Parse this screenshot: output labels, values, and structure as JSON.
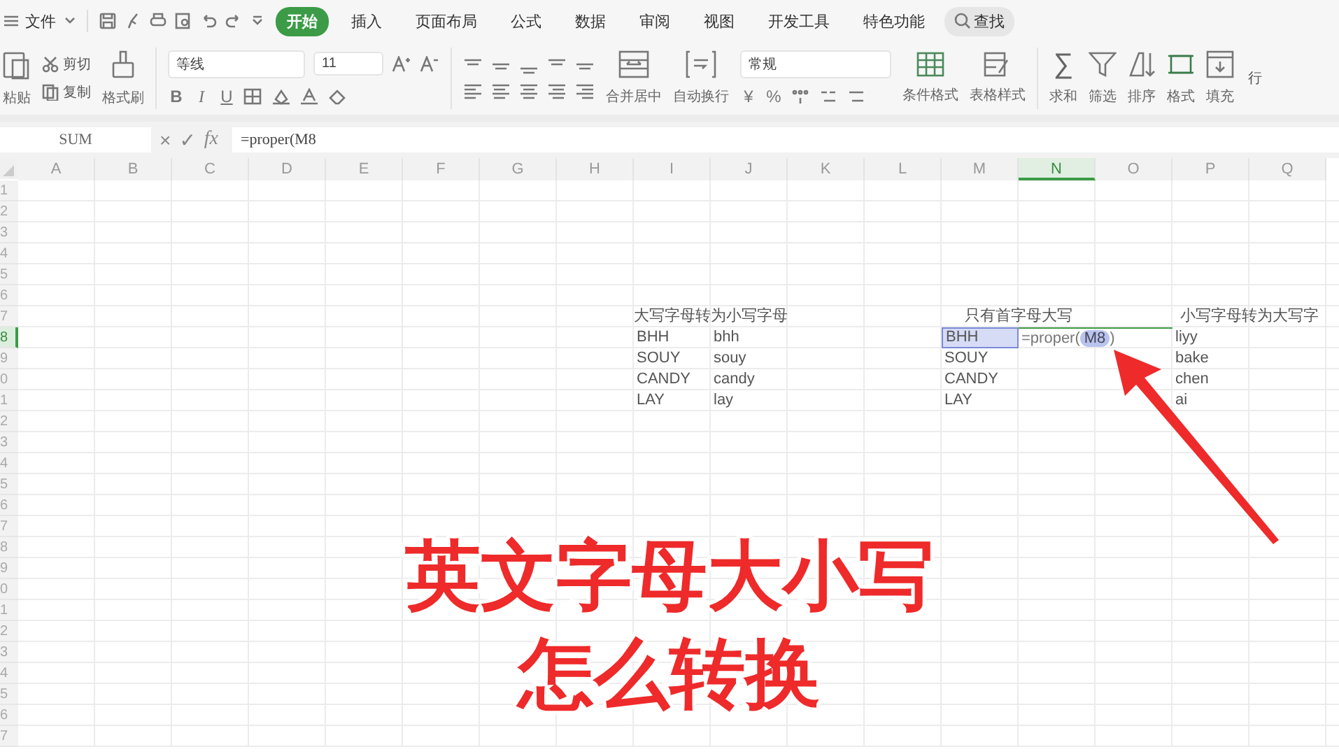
{
  "menu": {
    "label": "文件"
  },
  "tabs": [
    {
      "label": "开始",
      "selected": true
    },
    {
      "label": "插入",
      "selected": false
    },
    {
      "label": "页面布局",
      "selected": false
    },
    {
      "label": "公式",
      "selected": false
    },
    {
      "label": "数据",
      "selected": false
    },
    {
      "label": "审阅",
      "selected": false
    },
    {
      "label": "视图",
      "selected": false
    },
    {
      "label": "开发工具",
      "selected": false
    },
    {
      "label": "特色功能",
      "selected": false
    }
  ],
  "search": {
    "label": "查找"
  },
  "ribbon": {
    "paste": "粘贴",
    "cut": "剪切",
    "copy": "复制",
    "format_painter": "格式刷",
    "font_name": "等线",
    "font_size": "11",
    "bold": "B",
    "italic": "I",
    "underline": "U",
    "merge": "合并居中",
    "wrap": "自动换行",
    "number_format": "常规",
    "currency": "¥",
    "percent": "%",
    "conditional": "条件格式",
    "table_style": "表格样式",
    "sum_symbol": "∑",
    "sum": "求和",
    "filter": "筛选",
    "sort": "排序",
    "format": "格式",
    "fill": "填充",
    "row_col": "行"
  },
  "formula_bar": {
    "name_box": "SUM",
    "cancel": "×",
    "confirm": "✓",
    "fx": "fx",
    "formula": "=proper(M8"
  },
  "sheet": {
    "columns": [
      {
        "label": "A",
        "selected": false
      },
      {
        "label": "B",
        "selected": false
      },
      {
        "label": "C",
        "selected": false
      },
      {
        "label": "D",
        "selected": false
      },
      {
        "label": "E",
        "selected": false
      },
      {
        "label": "F",
        "selected": false
      },
      {
        "label": "G",
        "selected": false
      },
      {
        "label": "H",
        "selected": false
      },
      {
        "label": "I",
        "selected": false
      },
      {
        "label": "J",
        "selected": false
      },
      {
        "label": "K",
        "selected": false
      },
      {
        "label": "L",
        "selected": false
      },
      {
        "label": "M",
        "selected": false
      },
      {
        "label": "N",
        "selected": true
      },
      {
        "label": "O",
        "selected": false
      },
      {
        "label": "P",
        "selected": false
      },
      {
        "label": "Q",
        "selected": false
      }
    ],
    "rows": [
      {
        "number": "1",
        "selected": false
      },
      {
        "number": "2",
        "selected": false
      },
      {
        "number": "3",
        "selected": false
      },
      {
        "number": "4",
        "selected": false
      },
      {
        "number": "5",
        "selected": false
      },
      {
        "number": "6",
        "selected": false
      },
      {
        "number": "7",
        "selected": false,
        "cells": {
          "I": {
            "text": "大写字母转为小写字母",
            "kind": "title"
          },
          "M": {
            "text": "只有首字母大写",
            "kind": "title"
          },
          "P": {
            "text": "小写字母转为大写字",
            "kind": "title"
          }
        }
      },
      {
        "number": "8",
        "selected": true,
        "cells": {
          "I": {
            "text": "BHH",
            "kind": "plain"
          },
          "J": {
            "text": "bhh",
            "kind": "plain"
          },
          "M": {
            "text": "BHH",
            "kind": "plain",
            "selected": true
          },
          "N": {
            "text": "=proper(",
            "reference": "M8",
            "suffix": ")",
            "kind": "editing"
          },
          "P": {
            "text": "liyy",
            "kind": "plain"
          }
        }
      },
      {
        "number": "9",
        "selected": false,
        "cells": {
          "I": {
            "text": "SOUY",
            "kind": "plain"
          },
          "J": {
            "text": "souy",
            "kind": "plain"
          },
          "M": {
            "text": "SOUY",
            "kind": "plain"
          },
          "P": {
            "text": "bake",
            "kind": "plain"
          }
        }
      },
      {
        "number": "0",
        "selected": false,
        "cells": {
          "I": {
            "text": "CANDY",
            "kind": "plain"
          },
          "J": {
            "text": "candy",
            "kind": "plain"
          },
          "M": {
            "text": "CANDY",
            "kind": "plain"
          },
          "P": {
            "text": "chen",
            "kind": "plain"
          }
        }
      },
      {
        "number": "1",
        "selected": false,
        "cells": {
          "I": {
            "text": "LAY",
            "kind": "plain"
          },
          "J": {
            "text": "lay",
            "kind": "plain"
          },
          "M": {
            "text": "LAY",
            "kind": "plain"
          },
          "P": {
            "text": "ai",
            "kind": "plain"
          }
        }
      },
      {
        "number": "2",
        "selected": false
      },
      {
        "number": "3",
        "selected": false
      },
      {
        "number": "4",
        "selected": false
      },
      {
        "number": "5",
        "selected": false
      },
      {
        "number": "6",
        "selected": false
      },
      {
        "number": "7",
        "selected": false
      },
      {
        "number": "8",
        "selected": false
      },
      {
        "number": "9",
        "selected": false
      },
      {
        "number": "0",
        "selected": false
      },
      {
        "number": "1",
        "selected": false
      },
      {
        "number": "2",
        "selected": false
      },
      {
        "number": "3",
        "selected": false
      },
      {
        "number": "4",
        "selected": false
      },
      {
        "number": "5",
        "selected": false
      },
      {
        "number": "6",
        "selected": false
      },
      {
        "number": "7",
        "selected": false
      }
    ]
  },
  "caption": {
    "lines": [
      "英文字母大小写",
      "怎么转换"
    ]
  }
}
